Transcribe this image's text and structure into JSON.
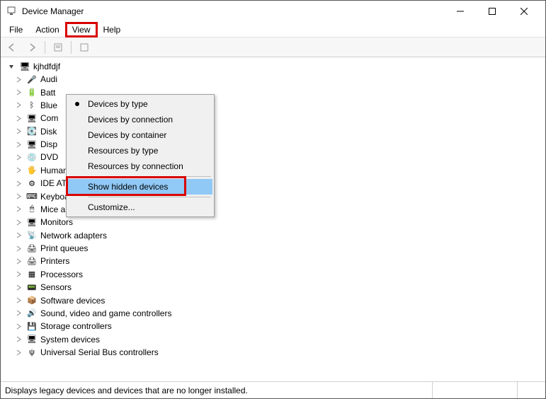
{
  "window": {
    "title": "Device Manager"
  },
  "menus": [
    "File",
    "Action",
    "View",
    "Help"
  ],
  "dropdown": {
    "items": [
      {
        "label": "Devices by type",
        "radio": true
      },
      {
        "label": "Devices by connection"
      },
      {
        "label": "Devices by container"
      },
      {
        "label": "Resources by type"
      },
      {
        "label": "Resources by connection"
      },
      {
        "sep": true
      },
      {
        "label": "Show hidden devices",
        "active": true
      },
      {
        "sep": true
      },
      {
        "label": "Customize..."
      }
    ]
  },
  "tree": {
    "root": "kjhdfdjf",
    "children": [
      {
        "label": "Audi",
        "icon": "audio"
      },
      {
        "label": "Batt",
        "icon": "battery"
      },
      {
        "label": "Blue",
        "icon": "bluetooth"
      },
      {
        "label": "Com",
        "icon": "computer"
      },
      {
        "label": "Disk",
        "icon": "disk"
      },
      {
        "label": "Disp",
        "icon": "display"
      },
      {
        "label": "DVD",
        "icon": "dvd"
      },
      {
        "label": "Human Interface Devices",
        "icon": "hid"
      },
      {
        "label": "IDE ATA/ATAPI controllers",
        "icon": "ide"
      },
      {
        "label": "Keyboards",
        "icon": "keyboard"
      },
      {
        "label": "Mice and other pointing devices",
        "icon": "mouse"
      },
      {
        "label": "Monitors",
        "icon": "monitor"
      },
      {
        "label": "Network adapters",
        "icon": "network"
      },
      {
        "label": "Print queues",
        "icon": "printer"
      },
      {
        "label": "Printers",
        "icon": "printer"
      },
      {
        "label": "Processors",
        "icon": "cpu"
      },
      {
        "label": "Sensors",
        "icon": "sensor"
      },
      {
        "label": "Software devices",
        "icon": "software"
      },
      {
        "label": "Sound, video and game controllers",
        "icon": "sound"
      },
      {
        "label": "Storage controllers",
        "icon": "storage"
      },
      {
        "label": "System devices",
        "icon": "system"
      },
      {
        "label": "Universal Serial Bus controllers",
        "icon": "usb"
      }
    ]
  },
  "icons": {
    "computer-small": "🖥",
    "audio": "🎤",
    "battery": "🔋",
    "bluetooth": "ᛒ",
    "computer": "🖥",
    "disk": "💽",
    "display": "🖥",
    "dvd": "💿",
    "hid": "🖐",
    "ide": "⚙",
    "keyboard": "⌨",
    "mouse": "🖱",
    "monitor": "🖥",
    "network": "📡",
    "printer": "🖨",
    "cpu": "▦",
    "sensor": "📟",
    "software": "📦",
    "sound": "🔊",
    "storage": "💾",
    "system": "🖥",
    "usb": "ψ"
  },
  "statusbar": {
    "text": "Displays legacy devices and devices that are no longer installed."
  }
}
